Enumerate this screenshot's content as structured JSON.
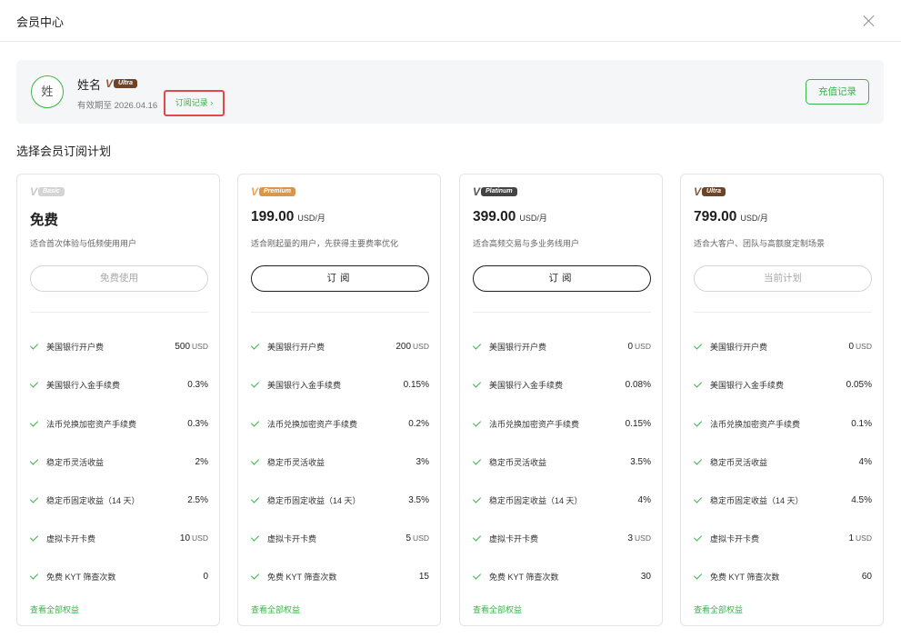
{
  "header": {
    "title": "会员中心"
  },
  "user": {
    "avatar_text": "姓",
    "name": "姓名",
    "tier_badge": "Ultra",
    "badge_mark": "V",
    "expiry": "有效期至 2026.04.16",
    "subscription_record": "订阅记录 ›",
    "recharge_record": "充值记录"
  },
  "section_title": "选择会员订阅计划",
  "plans": [
    {
      "badge": "Basic",
      "tier": "basic",
      "price": "免费",
      "unit": "",
      "desc": "适合首次体验与低频使用用户",
      "button": "免费使用",
      "button_state": "disabled",
      "more": "查看全部权益",
      "features": [
        {
          "name": "美国银行开户费",
          "value": "500",
          "unit": "USD"
        },
        {
          "name": "美国银行入金手续费",
          "value": "0.3%",
          "unit": ""
        },
        {
          "name": "法币兑换加密资产手续费",
          "value": "0.3%",
          "unit": ""
        },
        {
          "name": "稳定币灵活收益",
          "value": "2%",
          "unit": ""
        },
        {
          "name": "稳定币固定收益（14 天）",
          "value": "2.5%",
          "unit": ""
        },
        {
          "name": "虚拟卡开卡费",
          "value": "10",
          "unit": "USD"
        },
        {
          "name": "免费 KYT 筛查次数",
          "value": "0",
          "unit": ""
        }
      ]
    },
    {
      "badge": "Premium",
      "tier": "premium",
      "price": "199.00",
      "unit": "USD/月",
      "desc": "适合刚起量的用户，先获得主要费率优化",
      "button": "订阅",
      "button_state": "outlined",
      "more": "查看全部权益",
      "features": [
        {
          "name": "美国银行开户费",
          "value": "200",
          "unit": "USD"
        },
        {
          "name": "美国银行入金手续费",
          "value": "0.15%",
          "unit": ""
        },
        {
          "name": "法币兑换加密资产手续费",
          "value": "0.2%",
          "unit": ""
        },
        {
          "name": "稳定币灵活收益",
          "value": "3%",
          "unit": ""
        },
        {
          "name": "稳定币固定收益（14 天）",
          "value": "3.5%",
          "unit": ""
        },
        {
          "name": "虚拟卡开卡费",
          "value": "5",
          "unit": "USD"
        },
        {
          "name": "免费 KYT 筛查次数",
          "value": "15",
          "unit": ""
        }
      ]
    },
    {
      "badge": "Platinum",
      "tier": "platinum",
      "price": "399.00",
      "unit": "USD/月",
      "desc": "适合高频交易与多业务线用户",
      "button": "订阅",
      "button_state": "outlined",
      "more": "查看全部权益",
      "features": [
        {
          "name": "美国银行开户费",
          "value": "0",
          "unit": "USD"
        },
        {
          "name": "美国银行入金手续费",
          "value": "0.08%",
          "unit": ""
        },
        {
          "name": "法币兑换加密资产手续费",
          "value": "0.15%",
          "unit": ""
        },
        {
          "name": "稳定币灵活收益",
          "value": "3.5%",
          "unit": ""
        },
        {
          "name": "稳定币固定收益（14 天）",
          "value": "4%",
          "unit": ""
        },
        {
          "name": "虚拟卡开卡费",
          "value": "3",
          "unit": "USD"
        },
        {
          "name": "免费 KYT 筛查次数",
          "value": "30",
          "unit": ""
        }
      ]
    },
    {
      "badge": "Ultra",
      "tier": "ultra",
      "price": "799.00",
      "unit": "USD/月",
      "desc": "适合大客户、团队与高额度定制场景",
      "button": "当前计划",
      "button_state": "disabled",
      "more": "查看全部权益",
      "features": [
        {
          "name": "美国银行开户费",
          "value": "0",
          "unit": "USD"
        },
        {
          "name": "美国银行入金手续费",
          "value": "0.05%",
          "unit": ""
        },
        {
          "name": "法币兑换加密资产手续费",
          "value": "0.1%",
          "unit": ""
        },
        {
          "name": "稳定币灵活收益",
          "value": "4%",
          "unit": ""
        },
        {
          "name": "稳定币固定收益（14 天）",
          "value": "4.5%",
          "unit": ""
        },
        {
          "name": "虚拟卡开卡费",
          "value": "1",
          "unit": "USD"
        },
        {
          "name": "免费 KYT 筛查次数",
          "value": "60",
          "unit": ""
        }
      ]
    }
  ]
}
